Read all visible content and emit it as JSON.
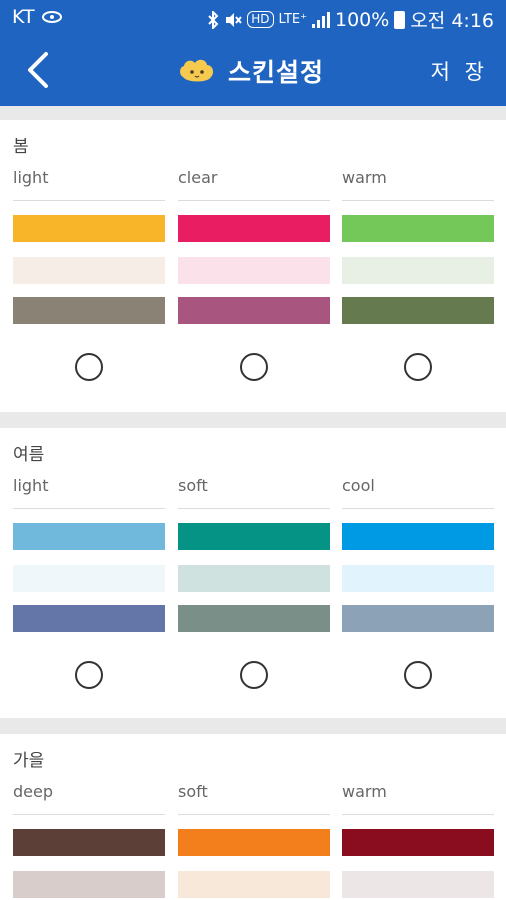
{
  "status": {
    "carrier": "KT",
    "battery": "100%",
    "time": "오전 4:16",
    "hd": "HD",
    "lte": "LTE⁺"
  },
  "header": {
    "title": "스킨설정",
    "save": "저 장"
  },
  "colors": {
    "appbar": "#1f64c1"
  },
  "seasons": [
    {
      "name": "봄",
      "tones": [
        {
          "name": "light",
          "colors": [
            "#f8b52a",
            "#f7ede7",
            "#8b8276"
          ],
          "selected": false
        },
        {
          "name": "clear",
          "colors": [
            "#e81d62",
            "#fbe2ea",
            "#a8567f"
          ],
          "selected": false
        },
        {
          "name": "warm",
          "colors": [
            "#73c859",
            "#e8efe5",
            "#667a4f"
          ],
          "selected": false
        }
      ]
    },
    {
      "name": "여름",
      "tones": [
        {
          "name": "light",
          "colors": [
            "#71b8dd",
            "#f0f7fb",
            "#6476a8"
          ],
          "selected": false
        },
        {
          "name": "soft",
          "colors": [
            "#049384",
            "#cfe2df",
            "#7a8f88"
          ],
          "selected": false
        },
        {
          "name": "cool",
          "colors": [
            "#0099e3",
            "#e1f3fc",
            "#8ca2b6"
          ],
          "selected": false
        }
      ]
    },
    {
      "name": "가을",
      "tones": [
        {
          "name": "deep",
          "colors": [
            "#5c3f37",
            "#d8cdca"
          ],
          "selected": false
        },
        {
          "name": "soft",
          "colors": [
            "#f27f1c",
            "#f8e8da"
          ],
          "selected": false
        },
        {
          "name": "warm",
          "colors": [
            "#8a0c1f",
            "#ece6e6"
          ],
          "selected": false
        }
      ]
    }
  ]
}
